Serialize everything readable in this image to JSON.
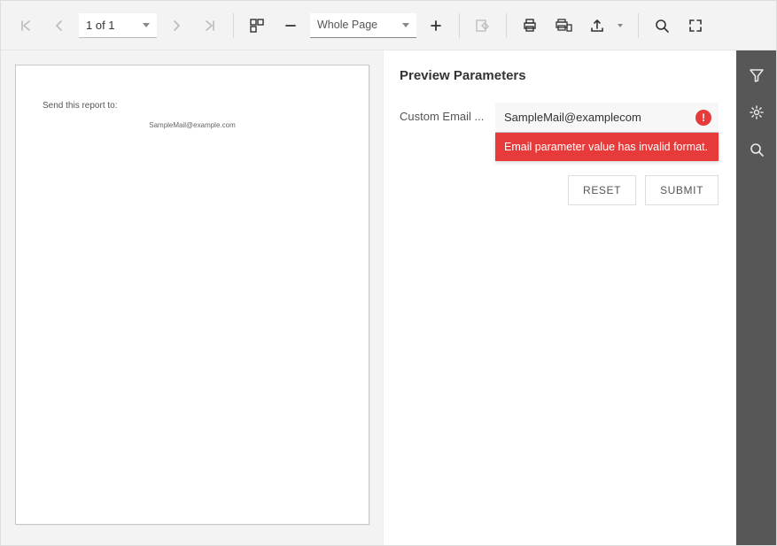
{
  "toolbar": {
    "page_display": "1 of 1",
    "zoom_display": "Whole Page"
  },
  "document": {
    "heading": "Send this report to:",
    "sample_email": "SampleMail@example.com"
  },
  "params": {
    "title": "Preview Parameters",
    "custom_email_label": "Custom Email ...",
    "custom_email_value": "SampleMail@examplecom",
    "error_message": "Email parameter value has invalid format.",
    "reset_label": "RESET",
    "submit_label": "SUBMIT"
  }
}
